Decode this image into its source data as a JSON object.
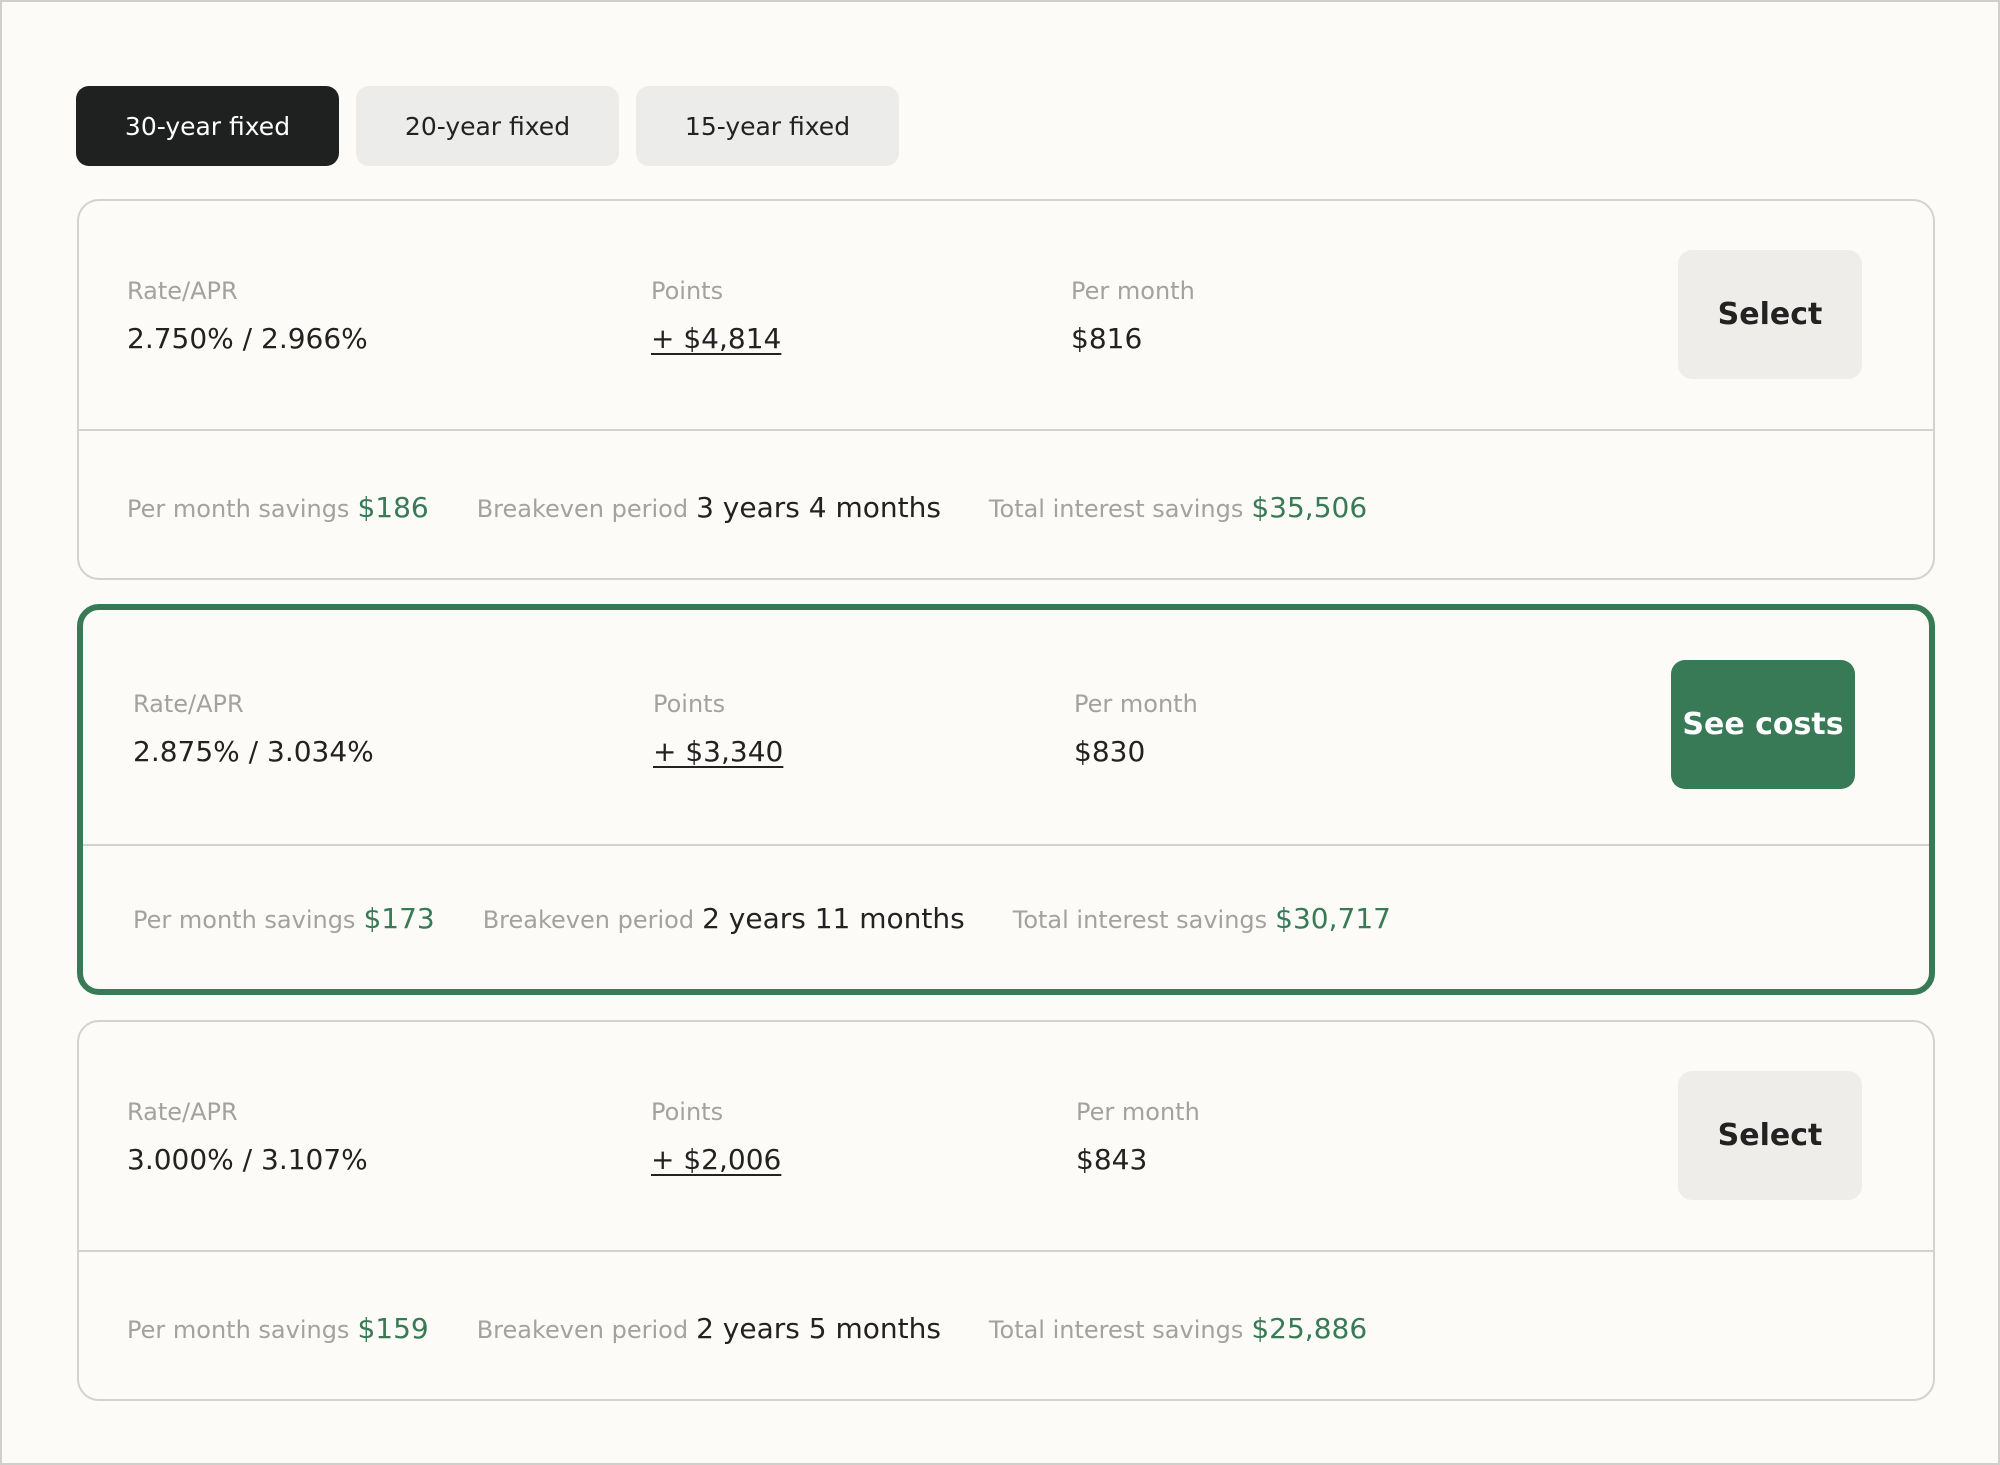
{
  "tabs": [
    {
      "label": "30-year fixed",
      "active": true
    },
    {
      "label": "20-year fixed",
      "active": false
    },
    {
      "label": "15-year fixed",
      "active": false
    }
  ],
  "offers": [
    {
      "rate_label": "Rate/APR",
      "rate_value": "2.750% / 2.966%",
      "points_label": "Points",
      "points_value": "+ $4,814",
      "month_label": "Per month",
      "month_value": "$816",
      "button_label": "Select",
      "savings_label": "Per month savings",
      "savings_value": "$186",
      "breakeven_label": "Breakeven period",
      "breakeven_value": "3 years 4 months",
      "interest_label": "Total interest savings",
      "interest_value": "$35,506"
    },
    {
      "rate_label": "Rate/APR",
      "rate_value": "2.875% / 3.034%",
      "points_label": "Points",
      "points_value": "+ $3,340",
      "month_label": "Per month",
      "month_value": "$830",
      "button_label": "See costs",
      "savings_label": "Per month savings",
      "savings_value": "$173",
      "breakeven_label": "Breakeven period",
      "breakeven_value": "2 years 11 months",
      "interest_label": "Total interest savings",
      "interest_value": "$30,717"
    },
    {
      "rate_label": "Rate/APR",
      "rate_value": "3.000% / 3.107%",
      "points_label": "Points",
      "points_value": "+ $2,006",
      "month_label": "Per month",
      "month_value": "$843",
      "button_label": "Select",
      "savings_label": "Per month savings",
      "savings_value": "$159",
      "breakeven_label": "Breakeven period",
      "breakeven_value": "2 years 5 months",
      "interest_label": "Total interest savings",
      "interest_value": "$25,886"
    }
  ],
  "colors": {
    "accent_green": "#377a55",
    "active_tab": "#1f2020",
    "muted_text": "#a2a29f"
  }
}
